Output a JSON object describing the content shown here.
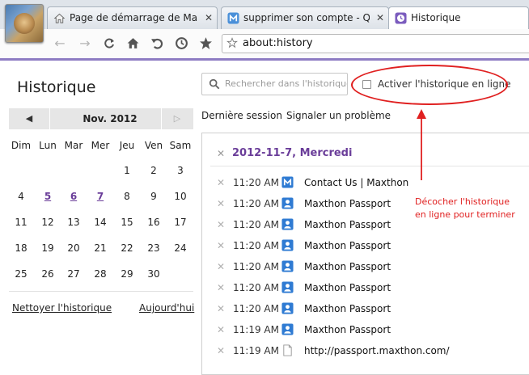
{
  "tabs": [
    {
      "label": "Page de démarrage de Maxt...",
      "icon": "home-icon"
    },
    {
      "label": "supprimer son compte - Que...",
      "icon": "maxthon-icon"
    },
    {
      "label": "Historique",
      "icon": "history-clock-icon"
    }
  ],
  "nav": {
    "address": "about:history"
  },
  "page": {
    "title": "Historique",
    "search_placeholder": "Rechercher dans l'historique",
    "online_history_label": "Activer l'historique en ligne",
    "online_history_checked": false,
    "links": {
      "last_session": "Dernière session",
      "report_problem": "Signaler un problème"
    }
  },
  "calendar": {
    "month_label": "Nov. 2012",
    "weekdays": [
      "Dim",
      "Lun",
      "Mar",
      "Mer",
      "Jeu",
      "Ven",
      "Sam"
    ],
    "highlighted_days": [
      "5",
      "6",
      "7"
    ],
    "weeks": [
      [
        "",
        "",
        "",
        "",
        "1",
        "2",
        "3"
      ],
      [
        "4",
        "5",
        "6",
        "7",
        "8",
        "9",
        "10"
      ],
      [
        "11",
        "12",
        "13",
        "14",
        "15",
        "16",
        "17"
      ],
      [
        "18",
        "19",
        "20",
        "21",
        "22",
        "23",
        "24"
      ],
      [
        "25",
        "26",
        "27",
        "28",
        "29",
        "30",
        ""
      ]
    ],
    "clear_history": "Nettoyer l'historique",
    "today": "Aujourd'hui"
  },
  "history": {
    "date_heading": "2012-11-7, Mercredi",
    "entries": [
      {
        "time": "11:20 AM",
        "title": "Contact Us | Maxthon",
        "icon": "maxthon-icon"
      },
      {
        "time": "11:20 AM",
        "title": "Maxthon Passport",
        "icon": "passport-icon"
      },
      {
        "time": "11:20 AM",
        "title": "Maxthon Passport",
        "icon": "passport-icon"
      },
      {
        "time": "11:20 AM",
        "title": "Maxthon Passport",
        "icon": "passport-icon"
      },
      {
        "time": "11:20 AM",
        "title": "Maxthon Passport",
        "icon": "passport-icon"
      },
      {
        "time": "11:20 AM",
        "title": "Maxthon Passport",
        "icon": "passport-icon"
      },
      {
        "time": "11:20 AM",
        "title": "Maxthon Passport",
        "icon": "passport-icon"
      },
      {
        "time": "11:19 AM",
        "title": "Maxthon Passport",
        "icon": "passport-icon"
      },
      {
        "time": "11:19 AM",
        "title": "http://passport.maxthon.com/",
        "icon": "page-icon"
      }
    ]
  },
  "annotation": {
    "line1": "Décocher l'historique",
    "line2": "en ligne pour terminer",
    "color": "#e02020"
  },
  "colors": {
    "accent": "#8e7cc3",
    "heading_purple": "#6a3d99"
  }
}
